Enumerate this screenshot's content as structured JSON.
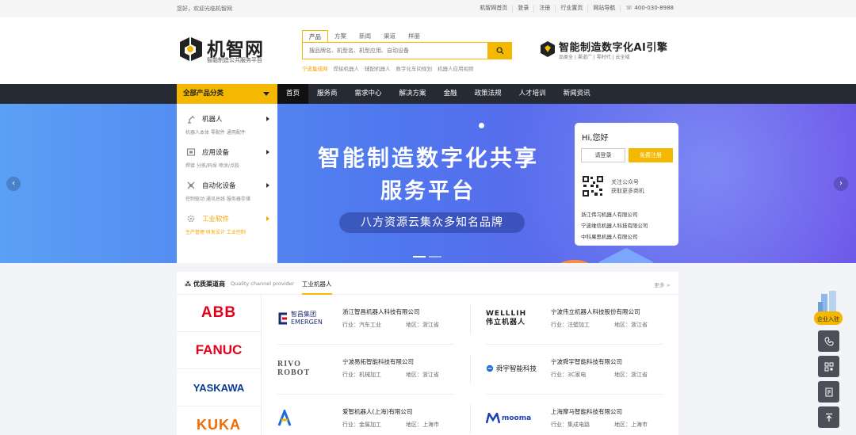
{
  "topbar": {
    "welcome": "您好，欢迎光临机智网",
    "links": [
      "机智网首页",
      "登录",
      "注册",
      "行业置页",
      "网站导航",
      "400-030-8988"
    ]
  },
  "logo": {
    "name": "机智网",
    "slogan": "智能制造公共服务平台"
  },
  "search": {
    "tabs": [
      "产品",
      "方案",
      "新闻",
      "渠道",
      "样册"
    ],
    "placeholder": "搜品牌名、机型名、机型应用、自动设备",
    "hot": [
      "宁波集成网",
      "焊接机器人",
      "辅配机器人",
      "数字化车间规划",
      "机器人应用视频"
    ]
  },
  "ad": {
    "title": "智能制造数字化AI引擎",
    "sub": "品类全 | 渠道广 | 零时代 | 云全域"
  },
  "nav": {
    "category": "全部产品分类",
    "items": [
      "首页",
      "服务商",
      "需求中心",
      "解决方案",
      "金融",
      "政策法规",
      "人才培训",
      "新闻资讯"
    ]
  },
  "categories": [
    {
      "title": "机器人",
      "sub": "机器人本体  零配件  通用配件"
    },
    {
      "title": "应用设备",
      "sub": "焊接  分拣/码垛  喷涂/点胶"
    },
    {
      "title": "自动化设备",
      "sub": "控制驱动  通讯总线  服务器存储"
    },
    {
      "title": "工业软件",
      "sub": "生产管理  研发设计  工业控制"
    }
  ],
  "banner": {
    "line1": "智能制造数字化共享",
    "line2": "服务平台",
    "pill": "八方资源云集众多知名品牌"
  },
  "login": {
    "greeting": "Hi,您好",
    "login_btn": "请登录",
    "register_btn": "免费注册",
    "qr_text1": "关注公众号",
    "qr_text2": "获取更多商机",
    "companies": [
      "浙江伟习机器人有限公司",
      "宁波维信机器人科技有限公司",
      "中科果思机器人有限公司"
    ]
  },
  "channel": {
    "title": "优质渠道商",
    "title_en": "Quality channel provider",
    "tab": "工业机器人",
    "more": "更多 >",
    "brands": [
      "ABB",
      "FANUC",
      "YASKAWA",
      "KUKA"
    ],
    "companies": [
      {
        "logo": "智昌集团 EMERGEN",
        "name": "浙江智昌机器人科技有限公司",
        "industry": "行业：汽车工业",
        "region": "地区：浙江省"
      },
      {
        "logo": "WELLLIH 伟立机器人",
        "name": "宁波伟立机器人科技股份有限公司",
        "industry": "行业：注塑加工",
        "region": "地区：浙江省"
      },
      {
        "logo": "RIVO ROBOT",
        "name": "宁波易拓智能科技有限公司",
        "industry": "行业：机械加工",
        "region": "地区：浙江省"
      },
      {
        "logo": "舜宇智能科技",
        "name": "宁波舜宇智能科技有限公司",
        "industry": "行业：3C家电",
        "region": "地区：浙江省"
      },
      {
        "logo": "AI",
        "name": "爱智机器人(上海)有限公司",
        "industry": "行业：金属加工",
        "region": "地区：上海市"
      },
      {
        "logo": "mooma",
        "name": "上海摩马智能科技有限公司",
        "industry": "行业：集成电路",
        "region": "地区：上海市"
      }
    ]
  },
  "sidebar": {
    "enter_label": "企业入驻"
  }
}
